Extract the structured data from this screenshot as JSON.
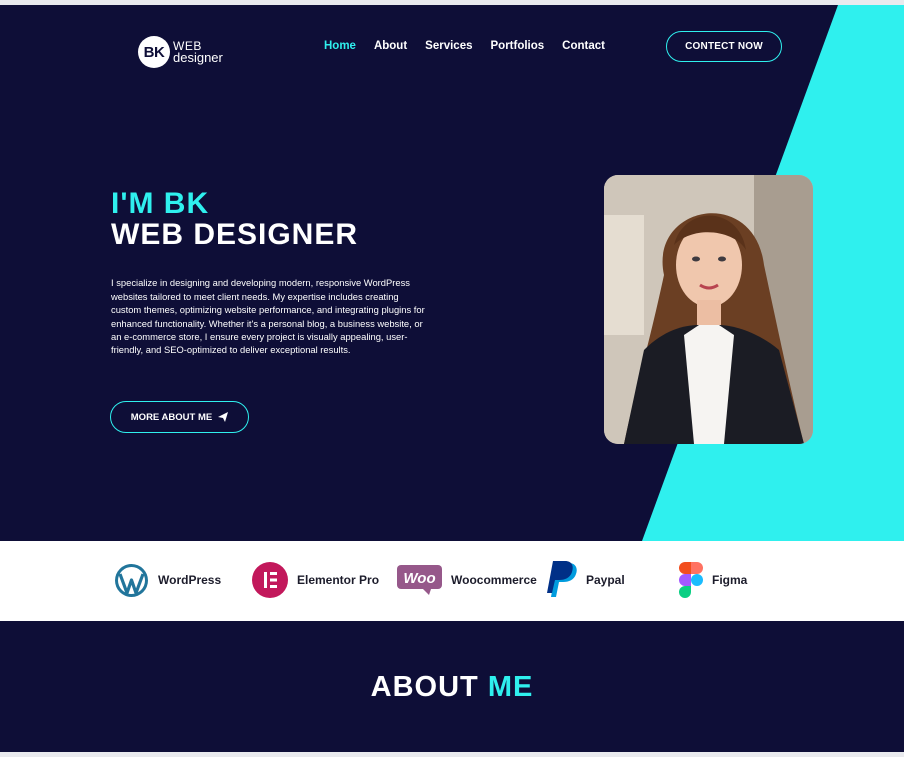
{
  "brand": {
    "badge": "BK",
    "line1": "WEB",
    "line2": "designer"
  },
  "nav": [
    {
      "label": "Home",
      "active": true
    },
    {
      "label": "About",
      "active": false
    },
    {
      "label": "Services",
      "active": false
    },
    {
      "label": "Portfolios",
      "active": false
    },
    {
      "label": "Contact",
      "active": false
    }
  ],
  "cta_label": "CONTECT NOW",
  "hero": {
    "line1": "I'M BK",
    "line2": "WEB DESIGNER",
    "description": "I specialize in designing and developing modern, responsive WordPress websites tailored to meet client needs. My expertise includes creating custom themes, optimizing website performance, and integrating plugins for enhanced functionality. Whether it's a personal blog, a business website, or an e-commerce store, I ensure every project is visually appealing, user-friendly, and SEO-optimized to deliver exceptional results.",
    "button_label": "MORE ABOUT ME"
  },
  "tools": [
    {
      "label": "WordPress",
      "icon": "wordpress-icon"
    },
    {
      "label": "Elementor Pro",
      "icon": "elementor-icon"
    },
    {
      "label": "Woocommerce",
      "icon": "woocommerce-icon",
      "badge": "Woo"
    },
    {
      "label": "Paypal",
      "icon": "paypal-icon"
    },
    {
      "label": "Figma",
      "icon": "figma-icon"
    }
  ],
  "about": {
    "word1": "ABOUT",
    "word2": "ME"
  },
  "colors": {
    "navy": "#0e0e37",
    "cyan": "#2ff0ee"
  }
}
